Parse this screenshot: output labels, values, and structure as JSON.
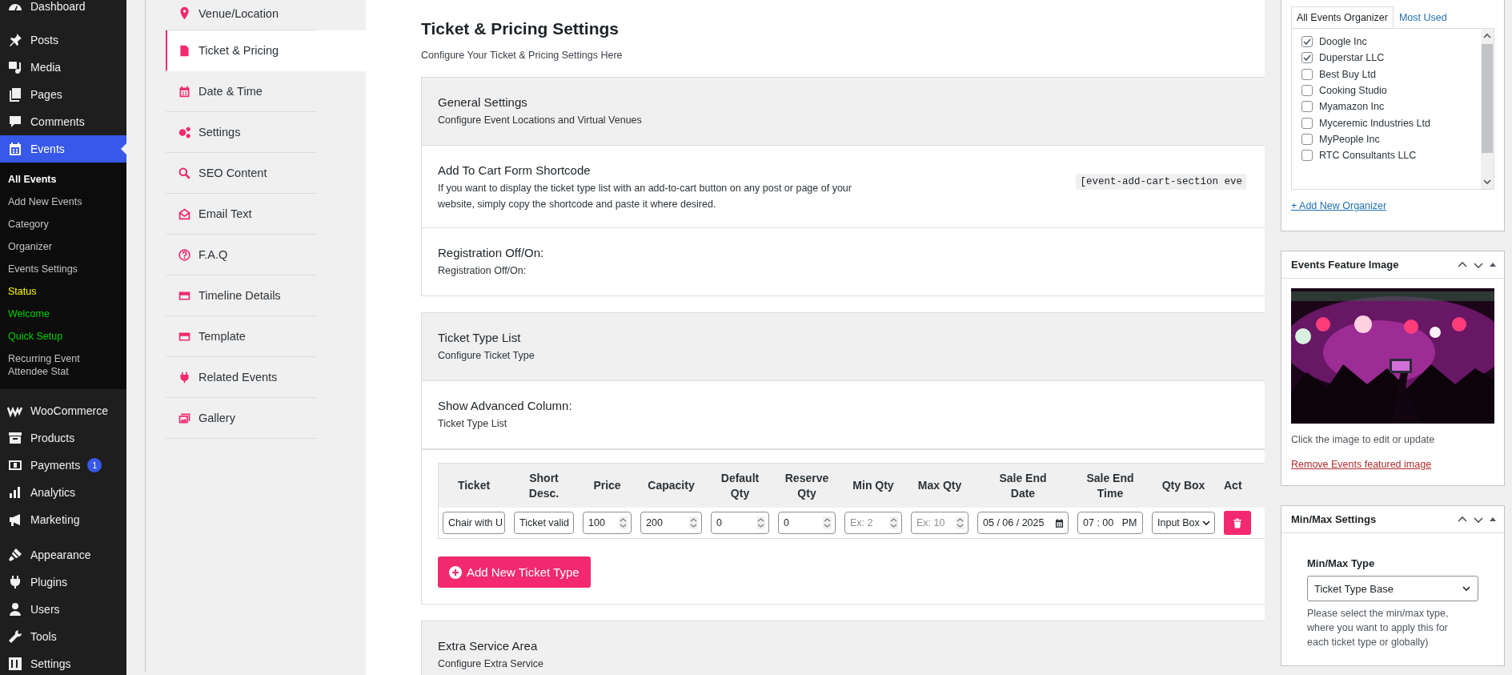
{
  "admin_menu": [
    {
      "label": "Dashboard",
      "selected": false
    },
    {
      "label": "Posts",
      "selected": false
    },
    {
      "label": "Media",
      "selected": false
    },
    {
      "label": "Pages",
      "selected": false
    },
    {
      "label": "Comments",
      "selected": false
    },
    {
      "label": "Events",
      "selected": true,
      "submenu": [
        {
          "label": "All Events",
          "selected": true,
          "color": "#ffffff"
        },
        {
          "label": "Add New Events",
          "selected": false,
          "color": "#c3c4c7"
        },
        {
          "label": "Category",
          "selected": false,
          "color": "#c3c4c7"
        },
        {
          "label": "Organizer",
          "selected": false,
          "color": "#c3c4c7"
        },
        {
          "label": "Events Settings",
          "selected": false,
          "color": "#c3c4c7"
        },
        {
          "label": "Status",
          "selected": false,
          "color": "#ffff00"
        },
        {
          "label": "Welcome",
          "selected": false,
          "color": "#00d200"
        },
        {
          "label": "Quick Setup",
          "selected": false,
          "color": "#00d200"
        },
        {
          "label": "Recurring Event Attendee Stat",
          "selected": false,
          "color": "#c3c4c7"
        }
      ]
    },
    {
      "label": "WooCommerce",
      "selected": false
    },
    {
      "label": "Products",
      "selected": false
    },
    {
      "label": "Payments",
      "selected": false,
      "badge": "1"
    },
    {
      "label": "Analytics",
      "selected": false
    },
    {
      "label": "Marketing",
      "selected": false
    },
    {
      "label": "Appearance",
      "selected": false
    },
    {
      "label": "Plugins",
      "selected": false
    },
    {
      "label": "Users",
      "selected": false
    },
    {
      "label": "Tools",
      "selected": false
    },
    {
      "label": "Settings",
      "selected": false
    }
  ],
  "settings_nav": [
    {
      "label": "Venue/Location",
      "selected": false
    },
    {
      "label": "Ticket & Pricing",
      "selected": true
    },
    {
      "label": "Date & Time",
      "selected": false
    },
    {
      "label": "Settings",
      "selected": false
    },
    {
      "label": "SEO Content",
      "selected": false
    },
    {
      "label": "Email Text",
      "selected": false
    },
    {
      "label": "F.A.Q",
      "selected": false
    },
    {
      "label": "Timeline Details",
      "selected": false
    },
    {
      "label": "Template",
      "selected": false
    },
    {
      "label": "Related Events",
      "selected": false
    },
    {
      "label": "Gallery",
      "selected": false
    }
  ],
  "page": {
    "title": "Ticket & Pricing Settings",
    "subtitle": "Configure Your Ticket & Pricing Settings Here"
  },
  "cards": [
    {
      "sections": [
        {
          "kind": "header",
          "title": "General Settings",
          "description": "Configure Event Locations and Virtual Venues"
        },
        {
          "kind": "row",
          "title": "Add To Cart Form Shortcode",
          "description": "If you want to display the ticket type list with an add-to-cart button on any post or page of your website, simply copy the shortcode and paste it where desired.",
          "shortcode": "[event-add-cart-section eve"
        },
        {
          "kind": "row",
          "title": "Registration Off/On:",
          "description": "Registration Off/On:"
        }
      ]
    },
    {
      "sections": [
        {
          "kind": "header",
          "title": "Ticket Type List",
          "description": "Configure Ticket Type"
        },
        {
          "kind": "row",
          "title": "Show Advanced Column:",
          "description": "Ticket Type List"
        }
      ],
      "ticket_table": {
        "columns": [
          "Ticket",
          "Short Desc.",
          "Price",
          "Capacity",
          "Default Qty",
          "Reserve Qty",
          "Min Qty",
          "Max Qty",
          "Sale End Date",
          "Sale End Time",
          "Qty Box",
          "Act"
        ],
        "rows": [
          {
            "cells": [
              {
                "kind": "text",
                "value": "Chair with U"
              },
              {
                "kind": "text",
                "value": "Ticket valid"
              },
              {
                "kind": "number",
                "value": "100"
              },
              {
                "kind": "number",
                "value": "200"
              },
              {
                "kind": "number",
                "value": "0"
              },
              {
                "kind": "number",
                "value": "0"
              },
              {
                "kind": "number",
                "placeholder": "Ex: 2"
              },
              {
                "kind": "number",
                "placeholder": "Ex: 10"
              },
              {
                "kind": "date",
                "value": "05 / 06 / 2025"
              },
              {
                "kind": "time",
                "value": "07 : 00   PM"
              },
              {
                "kind": "select",
                "value": "Input Box"
              },
              {
                "kind": "delete"
              }
            ]
          }
        ]
      },
      "add_button": "Add New Ticket Type"
    },
    {
      "sections": [
        {
          "kind": "header",
          "title": "Extra Service Area",
          "description": "Configure Extra Service"
        }
      ]
    }
  ],
  "organizer_panel": {
    "tabs": [
      {
        "label": "All Events Organizer",
        "selected": true
      },
      {
        "label": "Most Used",
        "selected": false
      }
    ],
    "organizers": [
      {
        "label": "Doogle Inc",
        "checked": true
      },
      {
        "label": "Duperstar LLC",
        "checked": true
      },
      {
        "label": "Best Buy Ltd",
        "checked": false
      },
      {
        "label": "Cooking Studio",
        "checked": false
      },
      {
        "label": "Myamazon Inc",
        "checked": false
      },
      {
        "label": "Myceremic Industries Ltd",
        "checked": false
      },
      {
        "label": "MyPeople Inc",
        "checked": false
      },
      {
        "label": "RTC Consultants LLC",
        "checked": false
      }
    ],
    "add_link": "+ Add New Organizer"
  },
  "image_panel": {
    "title": "Events Feature Image",
    "caption": "Click the image to edit or update",
    "remove_link": "Remove Events featured image"
  },
  "minmax_panel": {
    "title": "Min/Max Settings",
    "field_label": "Min/Max Type",
    "select_value": "Ticket Type Base",
    "help": "Please select the min/max type, where you want to apply this for each ticket type or globally)"
  }
}
